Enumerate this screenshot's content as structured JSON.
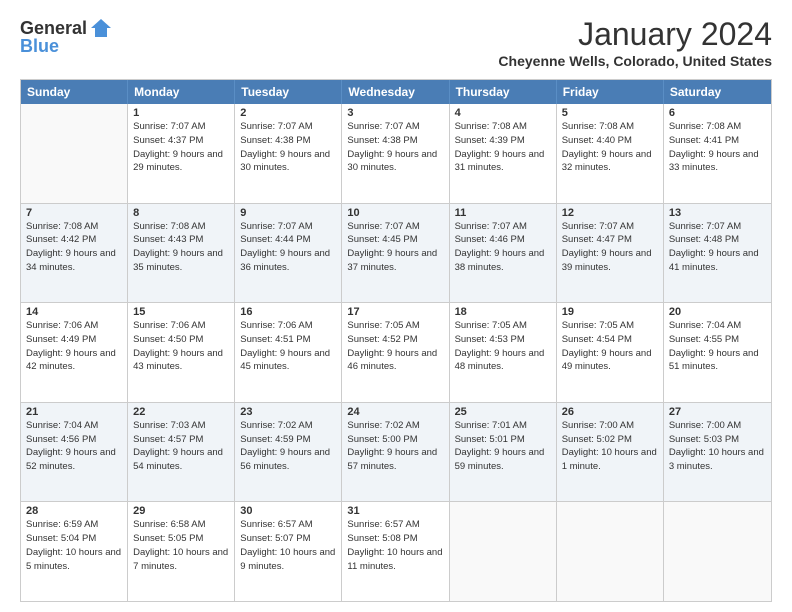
{
  "header": {
    "logo": {
      "general": "General",
      "blue": "Blue"
    },
    "title": "January 2024",
    "location": "Cheyenne Wells, Colorado, United States"
  },
  "weekdays": [
    "Sunday",
    "Monday",
    "Tuesday",
    "Wednesday",
    "Thursday",
    "Friday",
    "Saturday"
  ],
  "rows": [
    [
      {
        "day": "",
        "empty": true
      },
      {
        "day": "1",
        "sunrise": "7:07 AM",
        "sunset": "4:37 PM",
        "daylight": "9 hours and 29 minutes."
      },
      {
        "day": "2",
        "sunrise": "7:07 AM",
        "sunset": "4:38 PM",
        "daylight": "9 hours and 30 minutes."
      },
      {
        "day": "3",
        "sunrise": "7:07 AM",
        "sunset": "4:38 PM",
        "daylight": "9 hours and 30 minutes."
      },
      {
        "day": "4",
        "sunrise": "7:08 AM",
        "sunset": "4:39 PM",
        "daylight": "9 hours and 31 minutes."
      },
      {
        "day": "5",
        "sunrise": "7:08 AM",
        "sunset": "4:40 PM",
        "daylight": "9 hours and 32 minutes."
      },
      {
        "day": "6",
        "sunrise": "7:08 AM",
        "sunset": "4:41 PM",
        "daylight": "9 hours and 33 minutes."
      }
    ],
    [
      {
        "day": "7",
        "sunrise": "7:08 AM",
        "sunset": "4:42 PM",
        "daylight": "9 hours and 34 minutes."
      },
      {
        "day": "8",
        "sunrise": "7:08 AM",
        "sunset": "4:43 PM",
        "daylight": "9 hours and 35 minutes."
      },
      {
        "day": "9",
        "sunrise": "7:07 AM",
        "sunset": "4:44 PM",
        "daylight": "9 hours and 36 minutes."
      },
      {
        "day": "10",
        "sunrise": "7:07 AM",
        "sunset": "4:45 PM",
        "daylight": "9 hours and 37 minutes."
      },
      {
        "day": "11",
        "sunrise": "7:07 AM",
        "sunset": "4:46 PM",
        "daylight": "9 hours and 38 minutes."
      },
      {
        "day": "12",
        "sunrise": "7:07 AM",
        "sunset": "4:47 PM",
        "daylight": "9 hours and 39 minutes."
      },
      {
        "day": "13",
        "sunrise": "7:07 AM",
        "sunset": "4:48 PM",
        "daylight": "9 hours and 41 minutes."
      }
    ],
    [
      {
        "day": "14",
        "sunrise": "7:06 AM",
        "sunset": "4:49 PM",
        "daylight": "9 hours and 42 minutes."
      },
      {
        "day": "15",
        "sunrise": "7:06 AM",
        "sunset": "4:50 PM",
        "daylight": "9 hours and 43 minutes."
      },
      {
        "day": "16",
        "sunrise": "7:06 AM",
        "sunset": "4:51 PM",
        "daylight": "9 hours and 45 minutes."
      },
      {
        "day": "17",
        "sunrise": "7:05 AM",
        "sunset": "4:52 PM",
        "daylight": "9 hours and 46 minutes."
      },
      {
        "day": "18",
        "sunrise": "7:05 AM",
        "sunset": "4:53 PM",
        "daylight": "9 hours and 48 minutes."
      },
      {
        "day": "19",
        "sunrise": "7:05 AM",
        "sunset": "4:54 PM",
        "daylight": "9 hours and 49 minutes."
      },
      {
        "day": "20",
        "sunrise": "7:04 AM",
        "sunset": "4:55 PM",
        "daylight": "9 hours and 51 minutes."
      }
    ],
    [
      {
        "day": "21",
        "sunrise": "7:04 AM",
        "sunset": "4:56 PM",
        "daylight": "9 hours and 52 minutes."
      },
      {
        "day": "22",
        "sunrise": "7:03 AM",
        "sunset": "4:57 PM",
        "daylight": "9 hours and 54 minutes."
      },
      {
        "day": "23",
        "sunrise": "7:02 AM",
        "sunset": "4:59 PM",
        "daylight": "9 hours and 56 minutes."
      },
      {
        "day": "24",
        "sunrise": "7:02 AM",
        "sunset": "5:00 PM",
        "daylight": "9 hours and 57 minutes."
      },
      {
        "day": "25",
        "sunrise": "7:01 AM",
        "sunset": "5:01 PM",
        "daylight": "9 hours and 59 minutes."
      },
      {
        "day": "26",
        "sunrise": "7:00 AM",
        "sunset": "5:02 PM",
        "daylight": "10 hours and 1 minute."
      },
      {
        "day": "27",
        "sunrise": "7:00 AM",
        "sunset": "5:03 PM",
        "daylight": "10 hours and 3 minutes."
      }
    ],
    [
      {
        "day": "28",
        "sunrise": "6:59 AM",
        "sunset": "5:04 PM",
        "daylight": "10 hours and 5 minutes."
      },
      {
        "day": "29",
        "sunrise": "6:58 AM",
        "sunset": "5:05 PM",
        "daylight": "10 hours and 7 minutes."
      },
      {
        "day": "30",
        "sunrise": "6:57 AM",
        "sunset": "5:07 PM",
        "daylight": "10 hours and 9 minutes."
      },
      {
        "day": "31",
        "sunrise": "6:57 AM",
        "sunset": "5:08 PM",
        "daylight": "10 hours and 11 minutes."
      },
      {
        "day": "",
        "empty": true
      },
      {
        "day": "",
        "empty": true
      },
      {
        "day": "",
        "empty": true
      }
    ]
  ]
}
